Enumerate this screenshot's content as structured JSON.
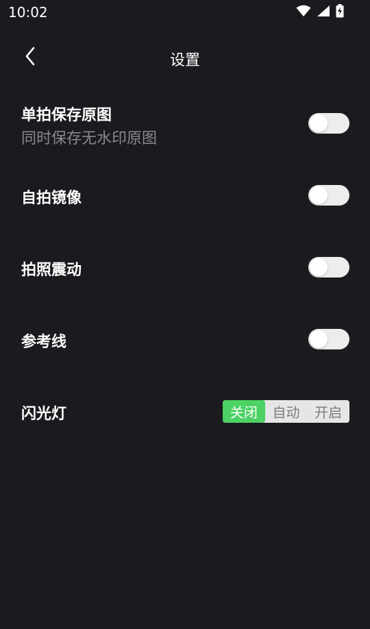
{
  "status_bar": {
    "time": "10:02",
    "icons": [
      "wifi-icon",
      "signal-icon",
      "battery-charging-icon"
    ]
  },
  "header": {
    "title": "设置",
    "back_icon": "chevron-left-icon"
  },
  "settings": [
    {
      "label": "单拍保存原图",
      "sublabel": "同时保存无水印原图",
      "enabled": false
    },
    {
      "label": "自拍镜像",
      "enabled": false
    },
    {
      "label": "拍照震动",
      "enabled": false
    },
    {
      "label": "参考线",
      "enabled": false
    }
  ],
  "flash": {
    "label": "闪光灯",
    "options": [
      "关闭",
      "自动",
      "开启"
    ],
    "selected": "关闭"
  },
  "colors": {
    "background": "#1b1b1f",
    "toggle_off": "#ededed",
    "accent": "#4cd264",
    "secondary_text": "#8a8a8e"
  }
}
